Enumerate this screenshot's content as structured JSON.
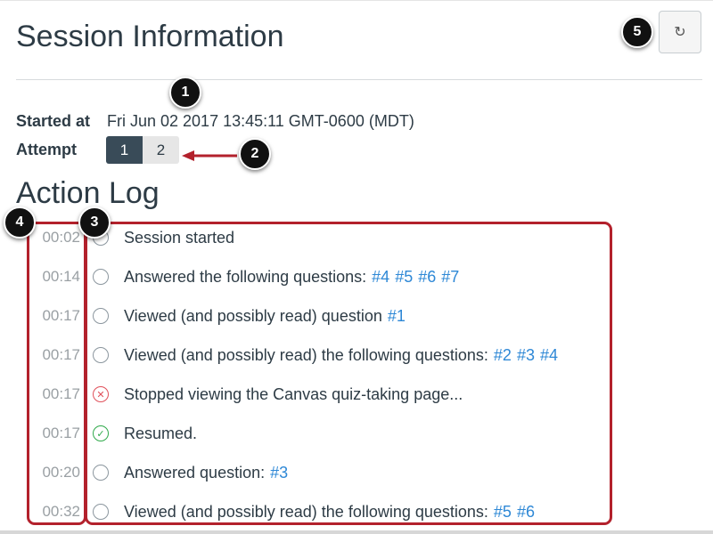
{
  "header": {
    "title": "Session Information",
    "refresh_glyph": "↻"
  },
  "details": {
    "started_label": "Started at",
    "started_value": "Fri Jun 02 2017 13:45:11 GMT-0600 (MDT)",
    "attempt_label": "Attempt",
    "attempts": [
      "1",
      "2"
    ],
    "active_attempt": "1"
  },
  "log": {
    "title": "Action Log",
    "entries": [
      {
        "time": "00:02",
        "text": "Session started",
        "status": "neutral",
        "links": []
      },
      {
        "time": "00:14",
        "text": "Answered the following questions:",
        "status": "neutral",
        "links": [
          "#4",
          "#5",
          "#6",
          "#7"
        ]
      },
      {
        "time": "00:17",
        "text": "Viewed (and possibly read) question",
        "status": "neutral",
        "links": [
          "#1"
        ]
      },
      {
        "time": "00:17",
        "text": "Viewed (and possibly read) the following questions:",
        "status": "neutral",
        "links": [
          "#2",
          "#3",
          "#4"
        ]
      },
      {
        "time": "00:17",
        "text": "Stopped viewing the Canvas quiz-taking page...",
        "status": "error",
        "links": []
      },
      {
        "time": "00:17",
        "text": "Resumed.",
        "status": "success",
        "links": []
      },
      {
        "time": "00:20",
        "text": "Answered question:",
        "status": "neutral",
        "links": [
          "#3"
        ]
      },
      {
        "time": "00:32",
        "text": "Viewed (and possibly read) the following questions:",
        "status": "neutral",
        "links": [
          "#5",
          "#6"
        ]
      }
    ]
  },
  "annotations": {
    "markers": [
      "1",
      "2",
      "3",
      "4",
      "5"
    ],
    "highlight_color": "#b3212c"
  },
  "colors": {
    "link": "#2e88d6",
    "active_attempt_bg": "#394b58",
    "error": "#e0505a",
    "success": "#2fa94a"
  },
  "icons": {
    "error_glyph": "✕",
    "success_glyph": "✓"
  }
}
